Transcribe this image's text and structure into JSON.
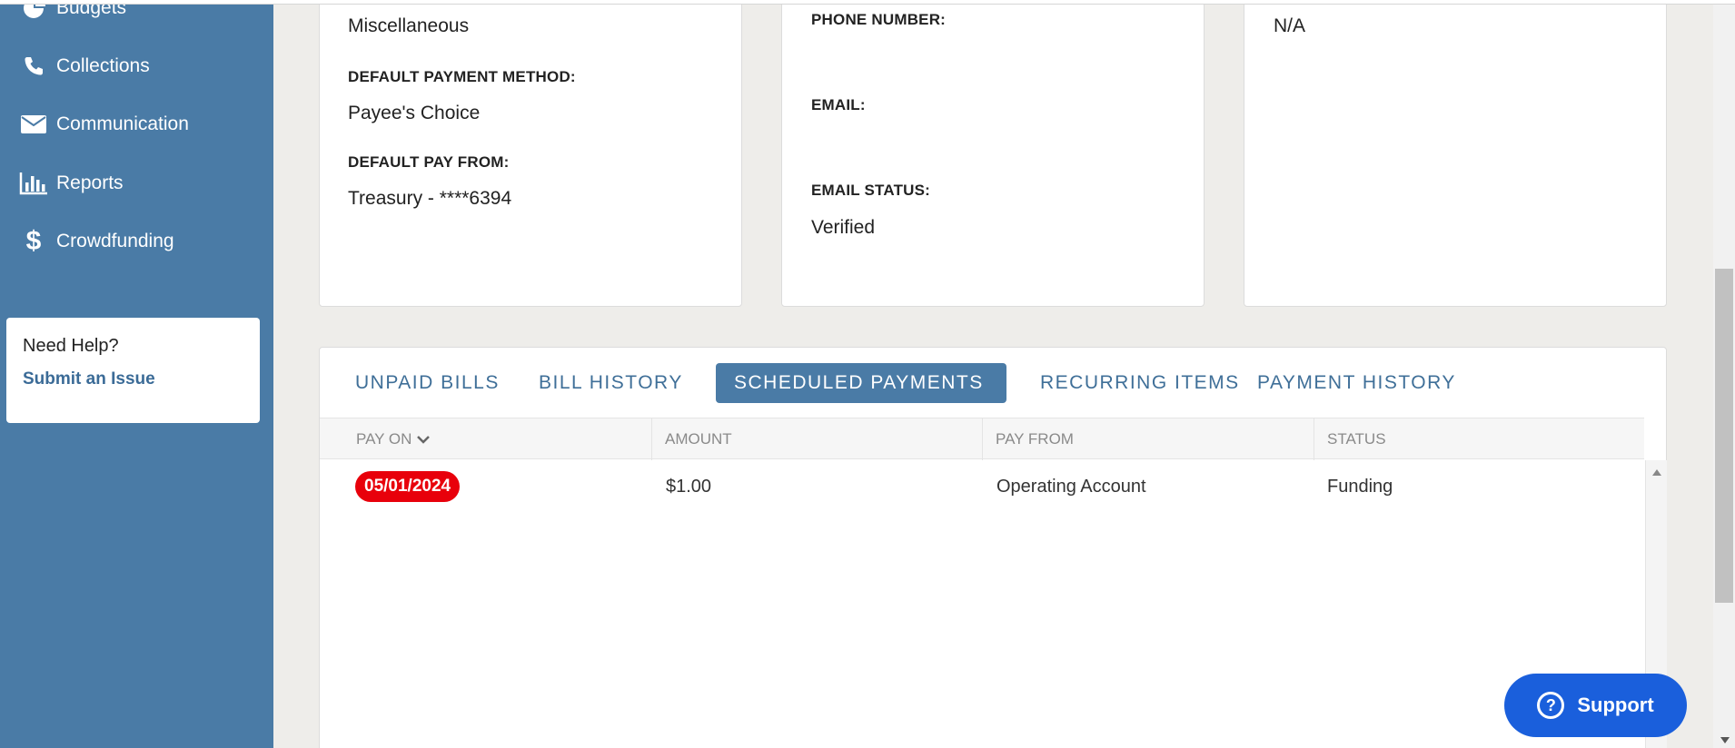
{
  "sidebar": {
    "items": [
      {
        "label": "Budgets",
        "icon": "pie-chart-icon"
      },
      {
        "label": "Collections",
        "icon": "phone-icon"
      },
      {
        "label": "Communication",
        "icon": "envelope-icon"
      },
      {
        "label": "Reports",
        "icon": "bar-chart-icon"
      },
      {
        "label": "Crowdfunding",
        "icon": "dollar-icon"
      }
    ],
    "help": {
      "title": "Need Help?",
      "link": "Submit an Issue"
    }
  },
  "card1": {
    "category_value": "Miscellaneous",
    "payment_method_label": "DEFAULT PAYMENT METHOD:",
    "payment_method_value": "Payee's Choice",
    "pay_from_label": "DEFAULT PAY FROM:",
    "pay_from_value": "Treasury - ****6394"
  },
  "card2": {
    "phone_label": "PHONE NUMBER:",
    "phone_value": "",
    "email_label": "EMAIL:",
    "email_value": "",
    "email_status_label": "EMAIL STATUS:",
    "email_status_value": "Verified"
  },
  "card3": {
    "value": "N/A"
  },
  "tabs": [
    {
      "label": "UNPAID BILLS",
      "active": false
    },
    {
      "label": "BILL HISTORY",
      "active": false
    },
    {
      "label": "SCHEDULED PAYMENTS",
      "active": true
    },
    {
      "label": "RECURRING ITEMS",
      "active": false
    },
    {
      "label": "PAYMENT HISTORY",
      "active": false
    }
  ],
  "table": {
    "columns": [
      "PAY ON",
      "AMOUNT",
      "PAY FROM",
      "STATUS"
    ],
    "rows": [
      {
        "pay_on": "05/01/2024",
        "amount": "$1.00",
        "pay_from": "Operating Account",
        "status": "Funding"
      }
    ]
  },
  "support": {
    "label": "Support"
  },
  "colors": {
    "sidebar": "#4a7ba6",
    "accent": "#4a7ba6",
    "date_badge": "#e8000b",
    "support_button": "#1a5fdc"
  }
}
